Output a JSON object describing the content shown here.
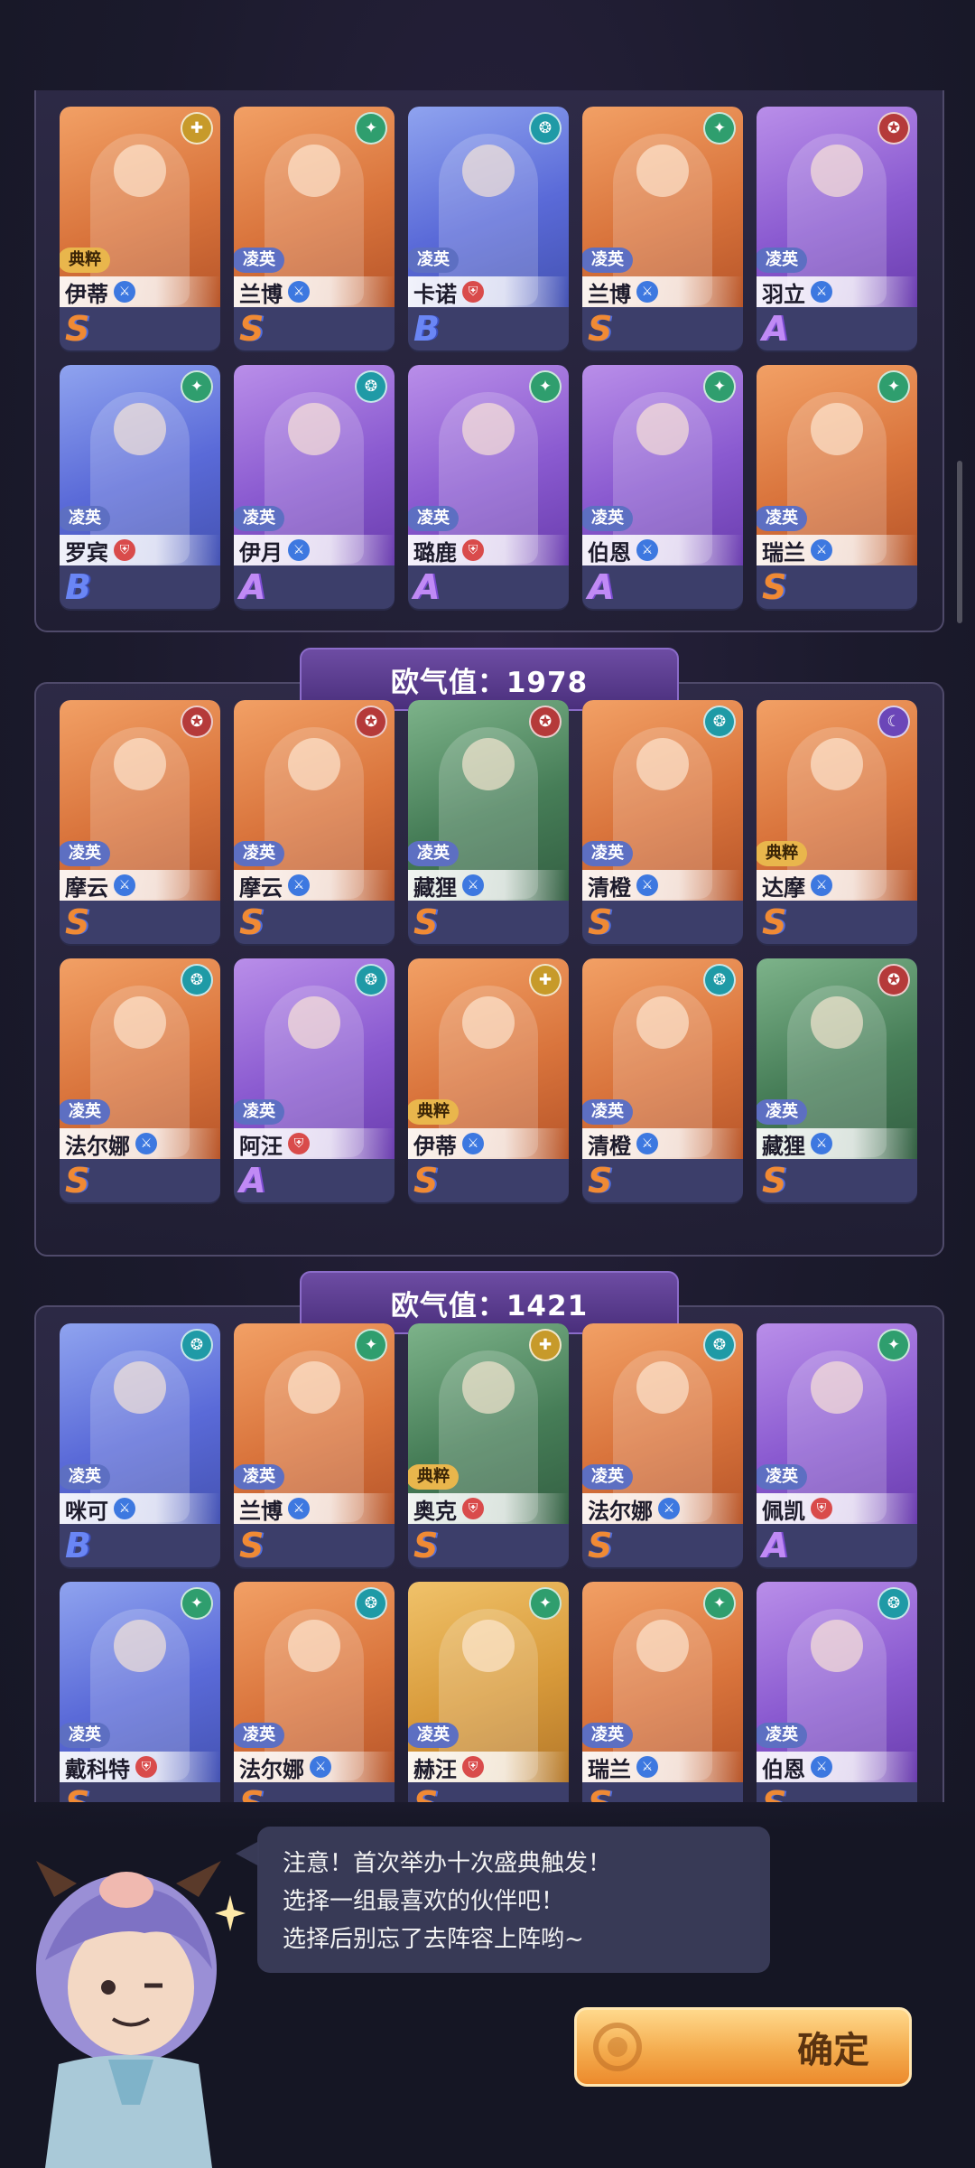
{
  "panels": [
    {
      "header": null,
      "cards": [
        {
          "name": "伊蒂",
          "rarity": "典粹",
          "grade": "S",
          "faction": "gold",
          "cls": "blue",
          "bg": "orange"
        },
        {
          "name": "兰博",
          "rarity": "凌英",
          "grade": "S",
          "faction": "green",
          "cls": "blue",
          "bg": "orange"
        },
        {
          "name": "卡诺",
          "rarity": "凌英",
          "grade": "B",
          "faction": "teal",
          "cls": "red",
          "bg": "blue"
        },
        {
          "name": "兰博",
          "rarity": "凌英",
          "grade": "S",
          "faction": "green",
          "cls": "blue",
          "bg": "orange"
        },
        {
          "name": "羽立",
          "rarity": "凌英",
          "grade": "A",
          "faction": "red",
          "cls": "blue",
          "bg": "purple"
        },
        {
          "name": "罗宾",
          "rarity": "凌英",
          "grade": "B",
          "faction": "green",
          "cls": "red",
          "bg": "blue"
        },
        {
          "name": "伊月",
          "rarity": "凌英",
          "grade": "A",
          "faction": "teal",
          "cls": "blue",
          "bg": "purple"
        },
        {
          "name": "璐鹿",
          "rarity": "凌英",
          "grade": "A",
          "faction": "green",
          "cls": "red",
          "bg": "purple"
        },
        {
          "name": "伯恩",
          "rarity": "凌英",
          "grade": "A",
          "faction": "green",
          "cls": "blue",
          "bg": "purple"
        },
        {
          "name": "瑞兰",
          "rarity": "凌英",
          "grade": "S",
          "faction": "green",
          "cls": "blue",
          "bg": "orange"
        }
      ]
    },
    {
      "header": "欧气值：1978",
      "cards": [
        {
          "name": "摩云",
          "rarity": "凌英",
          "grade": "S",
          "faction": "red",
          "cls": "blue",
          "bg": "orange"
        },
        {
          "name": "摩云",
          "rarity": "凌英",
          "grade": "S",
          "faction": "red",
          "cls": "blue",
          "bg": "orange"
        },
        {
          "name": "藏狸",
          "rarity": "凌英",
          "grade": "S",
          "faction": "red",
          "cls": "blue",
          "bg": "green"
        },
        {
          "name": "清橙",
          "rarity": "凌英",
          "grade": "S",
          "faction": "teal",
          "cls": "blue",
          "bg": "orange"
        },
        {
          "name": "达摩",
          "rarity": "典粹",
          "grade": "S",
          "faction": "purple",
          "cls": "blue",
          "bg": "orange"
        },
        {
          "name": "法尔娜",
          "rarity": "凌英",
          "grade": "S",
          "faction": "teal",
          "cls": "blue",
          "bg": "orange"
        },
        {
          "name": "阿汪",
          "rarity": "凌英",
          "grade": "A",
          "faction": "teal",
          "cls": "red",
          "bg": "purple"
        },
        {
          "name": "伊蒂",
          "rarity": "典粹",
          "grade": "S",
          "faction": "gold",
          "cls": "blue",
          "bg": "orange"
        },
        {
          "name": "清橙",
          "rarity": "凌英",
          "grade": "S",
          "faction": "teal",
          "cls": "blue",
          "bg": "orange"
        },
        {
          "name": "藏狸",
          "rarity": "凌英",
          "grade": "S",
          "faction": "red",
          "cls": "blue",
          "bg": "green"
        }
      ]
    },
    {
      "header": "欧气值：1421",
      "cards": [
        {
          "name": "咪可",
          "rarity": "凌英",
          "grade": "B",
          "faction": "teal",
          "cls": "blue",
          "bg": "blue"
        },
        {
          "name": "兰博",
          "rarity": "凌英",
          "grade": "S",
          "faction": "green",
          "cls": "blue",
          "bg": "orange"
        },
        {
          "name": "奥克",
          "rarity": "典粹",
          "grade": "S",
          "faction": "gold",
          "cls": "red",
          "bg": "green"
        },
        {
          "name": "法尔娜",
          "rarity": "凌英",
          "grade": "S",
          "faction": "teal",
          "cls": "blue",
          "bg": "orange"
        },
        {
          "name": "佩凯",
          "rarity": "凌英",
          "grade": "A",
          "faction": "green",
          "cls": "red",
          "bg": "purple"
        },
        {
          "name": "戴科特",
          "rarity": "凌英",
          "grade": "S",
          "faction": "green",
          "cls": "red",
          "bg": "blue"
        },
        {
          "name": "法尔娜",
          "rarity": "凌英",
          "grade": "S",
          "faction": "teal",
          "cls": "blue",
          "bg": "orange"
        },
        {
          "name": "赫汪",
          "rarity": "凌英",
          "grade": "S",
          "faction": "green",
          "cls": "red",
          "bg": "gold"
        },
        {
          "name": "瑞兰",
          "rarity": "凌英",
          "grade": "S",
          "faction": "green",
          "cls": "blue",
          "bg": "orange"
        },
        {
          "name": "伯恩",
          "rarity": "凌英",
          "grade": "S",
          "faction": "teal",
          "cls": "blue",
          "bg": "purple"
        }
      ]
    }
  ],
  "dialog": {
    "line1": "注意！首次举办十次盛典触发！",
    "line2": "选择一组最喜欢的伙伴吧！",
    "line3": "选择后别忘了去阵容上阵哟~"
  },
  "confirm_label": "确定"
}
